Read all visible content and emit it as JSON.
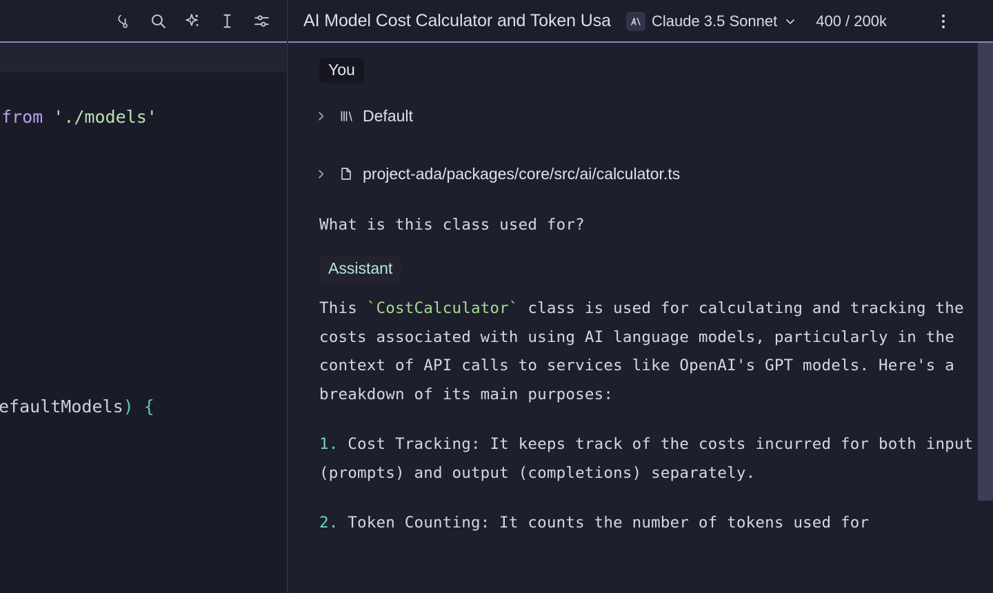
{
  "toolbar": {
    "icons": [
      {
        "name": "git-branch-icon",
        "label": "Source Control"
      },
      {
        "name": "search-icon",
        "label": "Search"
      },
      {
        "name": "sparkle-icon",
        "label": "AI Assist"
      },
      {
        "name": "text-cursor-icon",
        "label": "Text Cursor"
      },
      {
        "name": "sliders-icon",
        "label": "Settings"
      }
    ]
  },
  "header": {
    "chat_title": "AI Model Cost Calculator and Token Usa",
    "model": {
      "badge_glyph": "A\\",
      "name": "Claude 3.5 Sonnet",
      "chevron": "chevron-down-icon"
    },
    "token_usage": "400 / 200k",
    "overflow_menu": "more-options"
  },
  "editor": {
    "lines": [
      {
        "segments": [
          {
            "text": "from",
            "kind": "keyword"
          },
          {
            "text": " ",
            "kind": "plain"
          },
          {
            "text": "'./models'",
            "kind": "string"
          }
        ]
      },
      {
        "segments": [
          {
            "text": "efaultModels",
            "kind": "plain"
          },
          {
            "text": ")",
            "kind": "punct"
          },
          {
            "text": " ",
            "kind": "plain"
          },
          {
            "text": "{",
            "kind": "punct"
          }
        ]
      }
    ]
  },
  "chat": {
    "user_badge": "You",
    "assistant_badge": "Assistant",
    "context_items": [
      {
        "icon": "library-icon",
        "label": "Default",
        "chevron": "chevron-right-icon"
      },
      {
        "icon": "file-icon",
        "label": "project-ada/packages/core/src/ai/calculator.ts",
        "chevron": "chevron-right-icon"
      }
    ],
    "user_question": "What is this class used for?",
    "assistant_paragraph": {
      "before_code": "This ",
      "code": "`CostCalculator`",
      "after_code": " class is used for calculating and tracking the costs associated with using AI language models, particularly in the context of API calls to services like OpenAI's GPT models. Here's a breakdown of its main purposes:"
    },
    "list_items": [
      {
        "number": "1.",
        "text": " Cost Tracking: It keeps track of the costs incurred for both input (prompts) and output (completions) separately."
      },
      {
        "number": "2.",
        "text": " Token Counting: It counts the number of tokens used for"
      }
    ]
  },
  "colors": {
    "app_bg": "#1a1b28",
    "topbar_bg": "#1d1e2b",
    "chat_bg": "#1e1f2c",
    "header_rule": "#8e88c4",
    "accent_green": "#a8d98f",
    "accent_mint": "#6fd5b5",
    "keyword_purple": "#b9a2e8",
    "scrollbar": "#3d3d55"
  }
}
